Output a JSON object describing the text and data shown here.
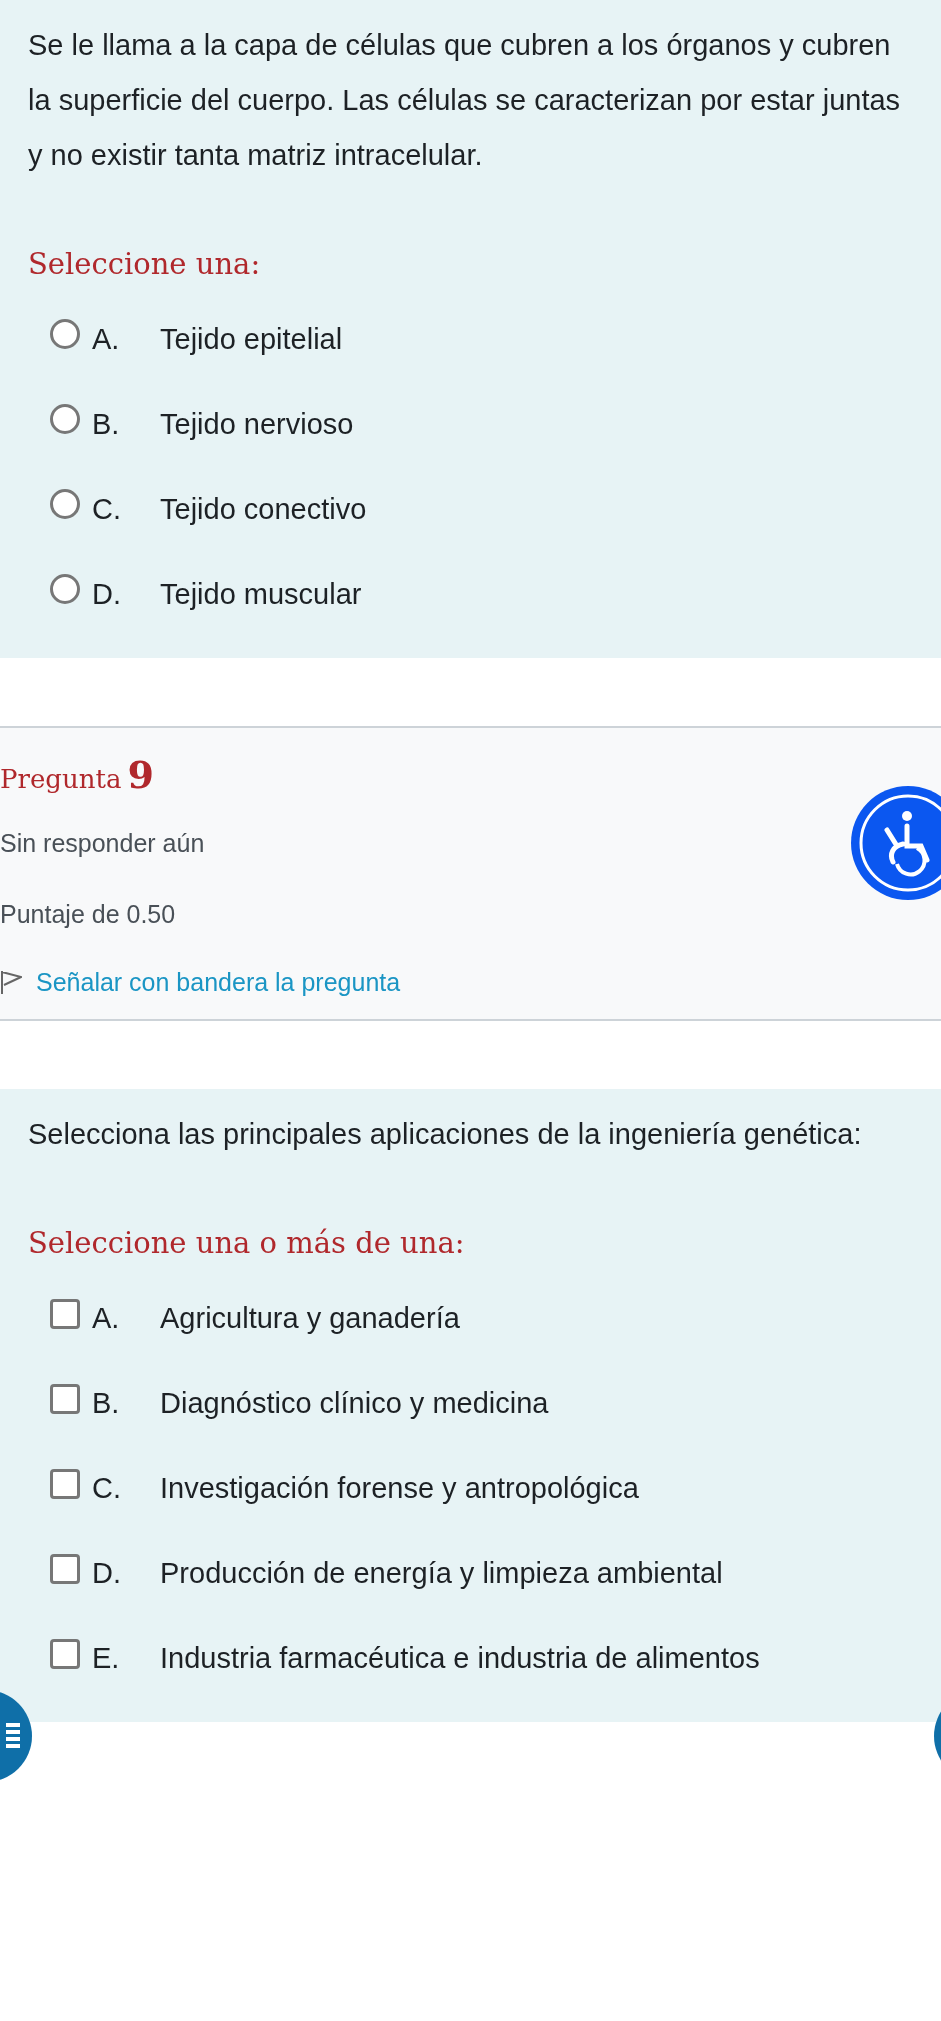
{
  "question_8": {
    "text": "Se le llama a la capa de células que cubren a los órganos y cubren la superficie del cuerpo. Las células se caracterizan por estar juntas y no existir tanta matriz intracelular.",
    "prompt": "Seleccione una:",
    "kind": "radio",
    "options": [
      {
        "letter": "A.",
        "label": "Tejido epitelial",
        "selected": false
      },
      {
        "letter": "B.",
        "label": "Tejido nervioso",
        "selected": false
      },
      {
        "letter": "C.",
        "label": "Tejido conectivo",
        "selected": false
      },
      {
        "letter": "D.",
        "label": "Tejido muscular",
        "selected": false
      }
    ]
  },
  "question_9_info": {
    "title": "Pregunta",
    "number": "9",
    "status": "Sin responder aún",
    "score": "Puntaje de 0.50",
    "flag_link": "Señalar con bandera la pregunta"
  },
  "question_9": {
    "text": "Selecciona las principales aplicaciones de la ingeniería genética:",
    "prompt": "Seleccione una o más de una:",
    "kind": "checkbox",
    "options": [
      {
        "letter": "A.",
        "label": "Agricultura y ganadería",
        "checked": false
      },
      {
        "letter": "B.",
        "label": "Diagnóstico clínico y medicina",
        "checked": false
      },
      {
        "letter": "C.",
        "label": "Investigación forense y antropológica",
        "checked": false
      },
      {
        "letter": "D.",
        "label": "Producción de energía y limpieza ambiental",
        "checked": false
      },
      {
        "letter": "E.",
        "label": "Industria farmacéutica e industria de alimentos",
        "checked": false
      }
    ]
  }
}
